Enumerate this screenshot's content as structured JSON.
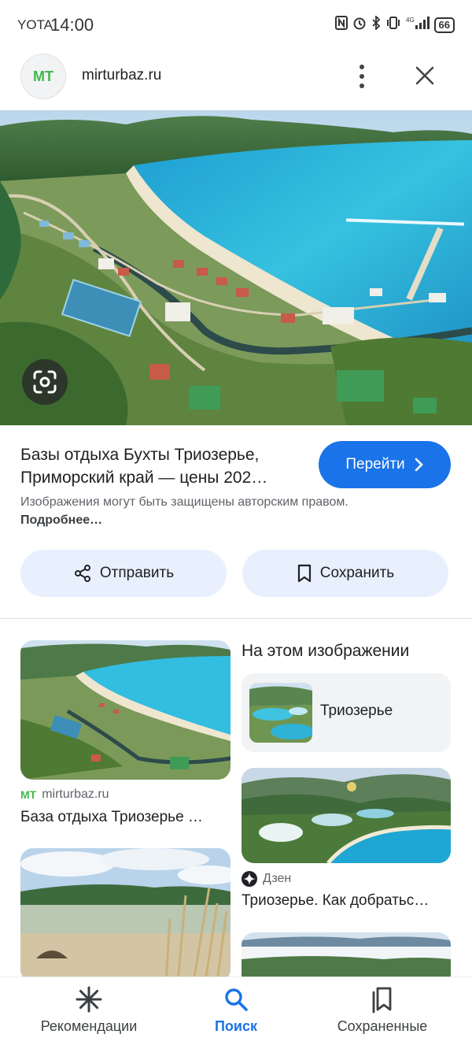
{
  "status_bar": {
    "carrier": "YOTA",
    "time": "14:00",
    "icons": [
      "nfc-icon",
      "alarm-icon",
      "bluetooth-icon",
      "vibrate-icon",
      "signal-icon"
    ],
    "network": "4G",
    "battery": "66"
  },
  "header": {
    "logo_text": "MT",
    "domain": "mirturbaz.ru",
    "menu_icon": "more-vert-icon",
    "close_icon": "close-icon"
  },
  "result": {
    "title_line1": "Базы отдыха Бухты Триозерье,",
    "title_line2": "Приморский край — цены 202…",
    "go_label": "Перейти",
    "copyright_text": "Изображения могут быть защищены авторским правом.",
    "copyright_more": "Подробнее…",
    "share_label": "Отправить",
    "save_label": "Сохранить"
  },
  "related": {
    "items": [
      {
        "source": "mirturbaz.ru",
        "source_badge": "MT",
        "title": "База отдыха Триозерье …"
      },
      {
        "source": "Дзен",
        "title": "Триозерье. Как добратьс…"
      }
    ],
    "in_image_heading": "На этом изображении",
    "entity_label": "Триозерье"
  },
  "bottom_nav": {
    "items": [
      {
        "label": "Рекомендации",
        "icon": "asterisk-icon"
      },
      {
        "label": "Поиск",
        "icon": "search-icon"
      },
      {
        "label": "Сохраненные",
        "icon": "bookmarks-icon"
      }
    ],
    "active": "Поиск"
  },
  "colors": {
    "accent": "#1a73e8",
    "pill_bg": "#e8f0fe",
    "sea": "#29b6d8"
  }
}
